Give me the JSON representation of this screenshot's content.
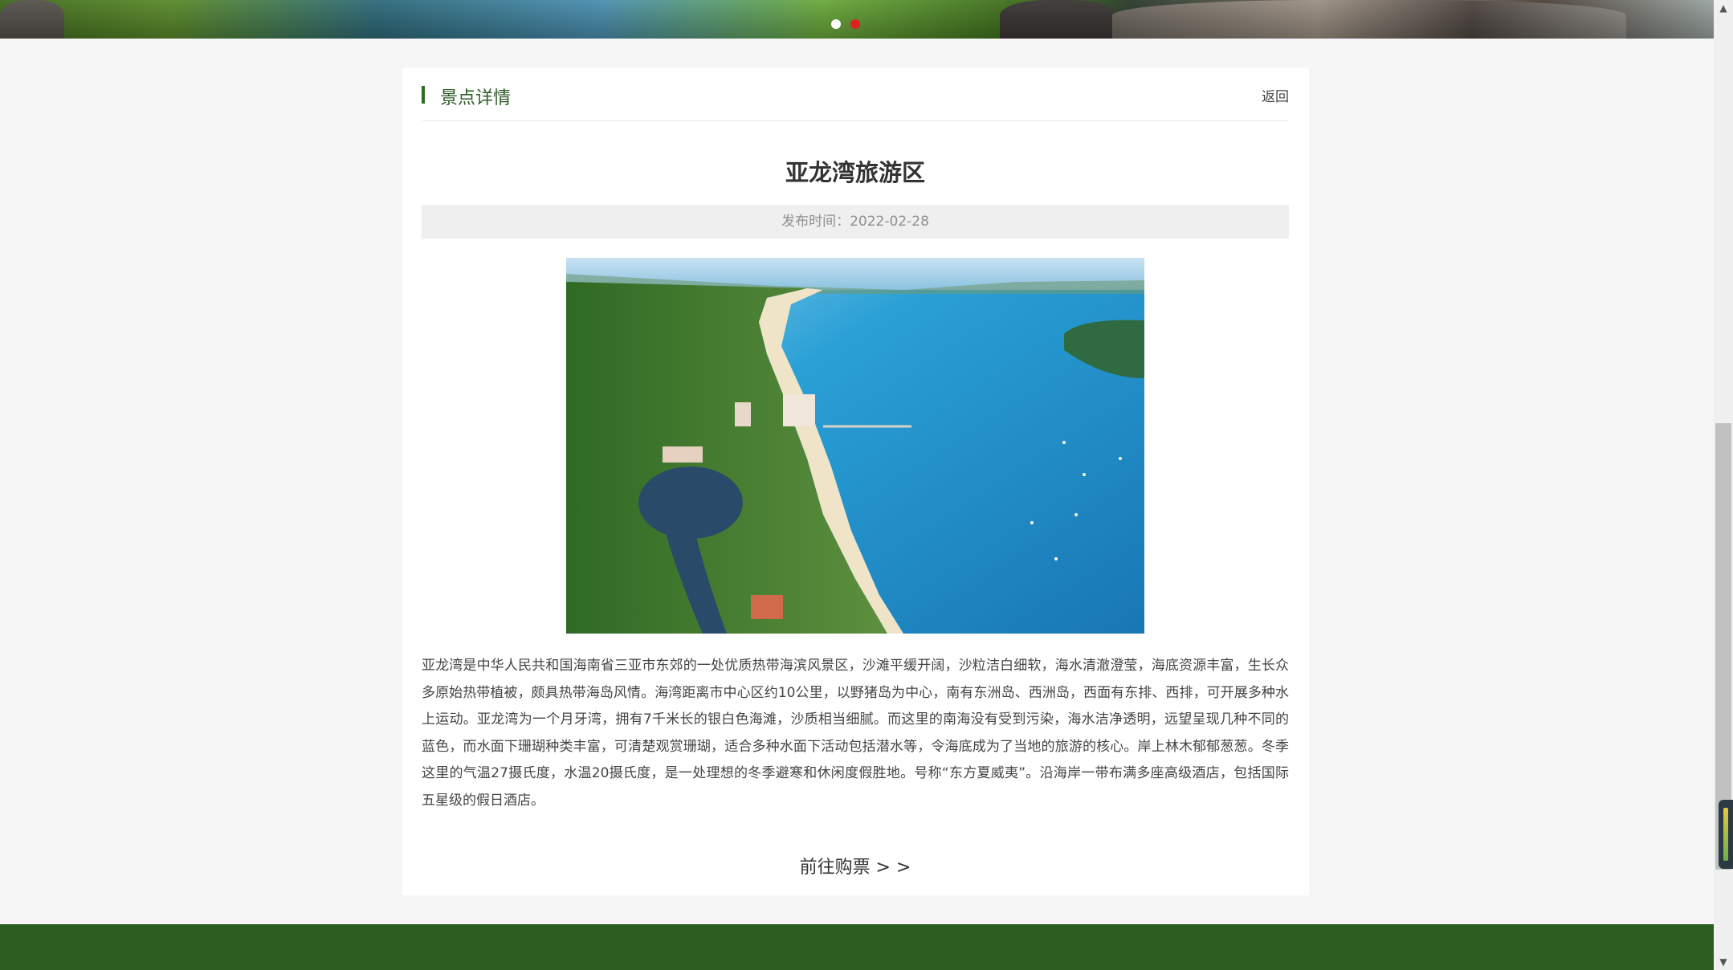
{
  "banner": {
    "slides": 2,
    "active_slide": 2,
    "colors": {
      "active_dot": "#e02020",
      "inactive_dot": "#ffffff"
    }
  },
  "section": {
    "title": "景点详情",
    "back_label": "返回",
    "accent_color": "#2e6b24"
  },
  "article": {
    "title": "亚龙湾旅游区",
    "meta_label": "发布时间：",
    "publish_date": "2022-02-28",
    "image_icon": "aerial-bay-photo",
    "body": "亚龙湾是中华人民共和国海南省三亚市东郊的一处优质热带海滨风景区，沙滩平缓开阔，沙粒洁白细软，海水清澈澄莹，海底资源丰富，生长众多原始热带植被，颇具热带海岛风情。海湾距离市中心区约10公里，以野猪岛为中心，南有东洲岛、西洲岛，西面有东排、西排，可开展多种水上运动。亚龙湾为一个月牙湾，拥有7千米长的银白色海滩，沙质相当细腻。而这里的南海没有受到污染，海水洁净透明，远望呈现几种不同的蓝色，而水面下珊瑚种类丰富，可清楚观赏珊瑚，适合多种水面下活动包括潜水等，令海底成为了当地的旅游的核心。岸上林木郁郁葱葱。冬季这里的气温27摄氏度，水温20摄氏度，是一处理想的冬季避寒和休闲度假胜地。号称“东方夏威夷”。沿海岸一带布满多座高级酒店，包括国际五星级的假日酒店。",
    "buy_label": "前往购票 > >"
  },
  "footer": {
    "color": "#2b5e1f"
  },
  "scrollbar": {
    "up_icon": "▲",
    "down_icon": "▼"
  }
}
